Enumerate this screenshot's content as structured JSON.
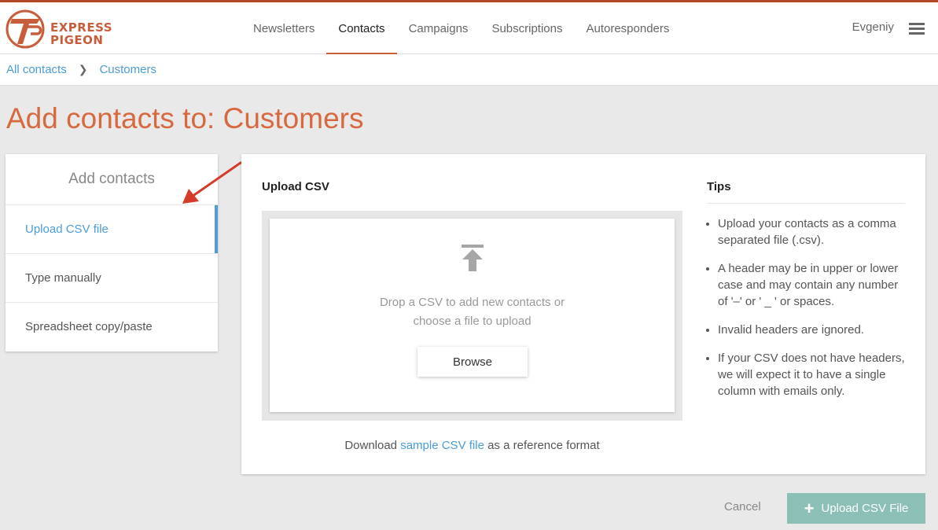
{
  "brand": {
    "line1": "EXPRESS",
    "line2": "PIGEON",
    "accent": "#c75d3a"
  },
  "nav": {
    "items": [
      {
        "label": "Newsletters",
        "active": false
      },
      {
        "label": "Contacts",
        "active": true
      },
      {
        "label": "Campaigns",
        "active": false
      },
      {
        "label": "Subscriptions",
        "active": false
      },
      {
        "label": "Autoresponders",
        "active": false
      }
    ],
    "user": "Evgeniy",
    "menu_icon": "hamburger-icon"
  },
  "breadcrumb": {
    "root": "All contacts",
    "current": "Customers"
  },
  "page": {
    "title": "Add contacts to: Customers"
  },
  "sidebar": {
    "title": "Add contacts",
    "items": [
      {
        "label": "Upload CSV file",
        "active": true
      },
      {
        "label": "Type manually",
        "active": false
      },
      {
        "label": "Spreadsheet copy/paste",
        "active": false
      }
    ]
  },
  "upload": {
    "title": "Upload CSV",
    "drop_line1": "Drop a CSV to add new contacts or",
    "drop_line2": "choose a file to upload",
    "browse": "Browse",
    "download_prefix": "Download",
    "download_link": "sample CSV file",
    "download_suffix": "as a reference format"
  },
  "tips": {
    "title": "Tips",
    "items": [
      "Upload your contacts as a comma separated file (.csv).",
      "A header may be in upper or lower case and may contain any number of '–' or ' _ ' or spaces.",
      "Invalid headers are ignored.",
      "If your CSV does not have headers, we will expect it to have a single column with emails only."
    ]
  },
  "footer": {
    "cancel": "Cancel",
    "upload": "Upload CSV File"
  },
  "colors": {
    "link": "#4a9dd6",
    "title": "#d7693f",
    "primary_button": "#8cbfb6",
    "annotation_arrow": "#d63a2a"
  }
}
